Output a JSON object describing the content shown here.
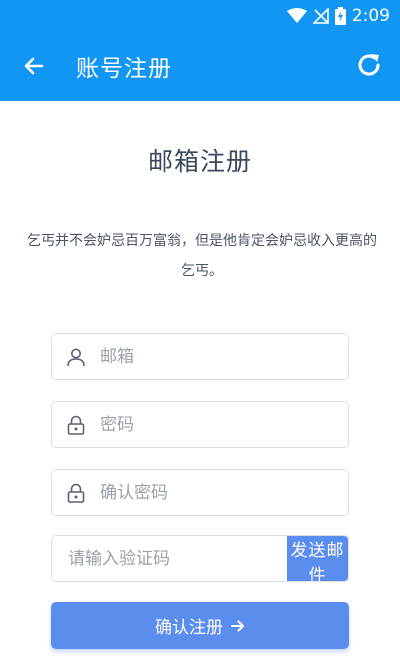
{
  "status_bar": {
    "time": "2:09",
    "icons": [
      "wifi-icon",
      "no-signal-icon",
      "battery-charging-icon"
    ]
  },
  "toolbar": {
    "title": "账号注册",
    "back_icon": "arrow-left-icon",
    "refresh_icon": "refresh-icon"
  },
  "page": {
    "heading": "邮箱注册",
    "quote": "乞丐并不会妒忌百万富翁，但是他肯定会妒忌收入更高的乞丐。"
  },
  "form": {
    "email_placeholder": "邮箱",
    "password_placeholder": "密码",
    "confirm_placeholder": "确认密码",
    "code_placeholder": "请输入验证码",
    "send_label": "发送邮件",
    "submit_label": "确认注册",
    "submit_icon": "arrow-right-icon"
  },
  "colors": {
    "app_bar": "#1296f3",
    "button": "#5b8def",
    "heading_text": "#3a4a5c"
  }
}
